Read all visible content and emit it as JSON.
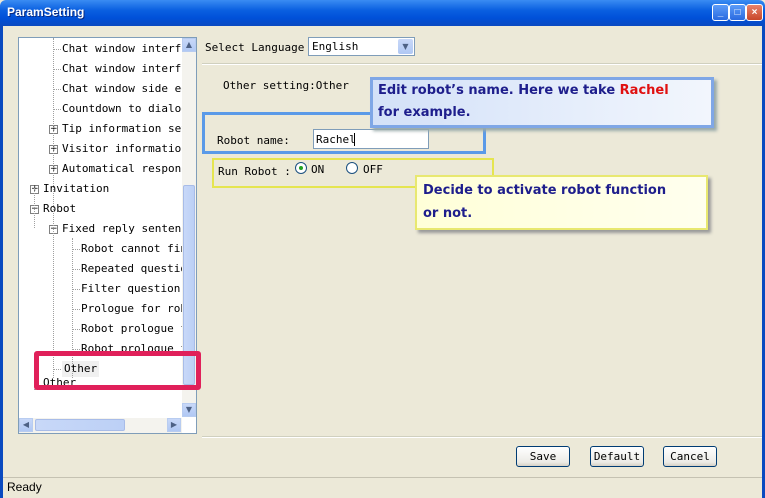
{
  "window": {
    "title": "ParamSetting",
    "controls": [
      "minimize-icon",
      "maximize-icon",
      "close-icon"
    ]
  },
  "tree": {
    "items": [
      {
        "label": "Chat window interfac",
        "level": 2,
        "expander": "none"
      },
      {
        "label": "Chat window interfac",
        "level": 2,
        "expander": "none"
      },
      {
        "label": "Chat window side edg",
        "level": 2,
        "expander": "none"
      },
      {
        "label": "Countdown to dialog",
        "level": 2,
        "expander": "none"
      },
      {
        "label": "Tip information sett",
        "level": 2,
        "expander": "plus"
      },
      {
        "label": "Visitor information",
        "level": 2,
        "expander": "plus"
      },
      {
        "label": "Automatical response",
        "level": 2,
        "expander": "plus"
      },
      {
        "label": "Invitation",
        "level": 1,
        "expander": "plus"
      },
      {
        "label": "Robot",
        "level": 1,
        "expander": "minus"
      },
      {
        "label": "Fixed reply sentence",
        "level": 2,
        "expander": "minus"
      },
      {
        "label": "Robot cannot find",
        "level": 3,
        "expander": "none"
      },
      {
        "label": "Repeated question",
        "level": 3,
        "expander": "none"
      },
      {
        "label": "Filter question",
        "level": 3,
        "expander": "none"
      },
      {
        "label": "Prologue for robo",
        "level": 3,
        "expander": "none"
      },
      {
        "label": "Robot prologue fo",
        "level": 3,
        "expander": "none"
      },
      {
        "label": "Robot prologue fo",
        "level": 3,
        "expander": "none"
      },
      {
        "label": "Other",
        "level": 2,
        "expander": "none",
        "selected": true
      },
      {
        "label": "Other",
        "level": 1,
        "expander": "none"
      }
    ]
  },
  "language": {
    "label": "Select Language",
    "value": "English"
  },
  "section": {
    "title": "Other setting:Other"
  },
  "robot_name": {
    "label": "Robot name:",
    "value": "Rachel"
  },
  "run_robot": {
    "label": "Run Robot :",
    "options": [
      {
        "label": "ON",
        "checked": true
      },
      {
        "label": "OFF",
        "checked": false
      }
    ]
  },
  "callouts": {
    "name_text": "Edit robot’s name. Here we take",
    "name_example": "Rachel",
    "name_text2": "for example.",
    "name_example_color": "#E01010",
    "run_line1": "Decide to activate robot function",
    "run_line2": "or not."
  },
  "buttons": {
    "save": "Save",
    "default": "Default",
    "cancel": "Cancel"
  },
  "status": {
    "text": "Ready"
  },
  "colors": {
    "titlebar": "#0A5FE0",
    "highlight_red": "#E0205A",
    "highlight_blue": "#5A9AE8",
    "highlight_yellow": "#E5E550"
  }
}
